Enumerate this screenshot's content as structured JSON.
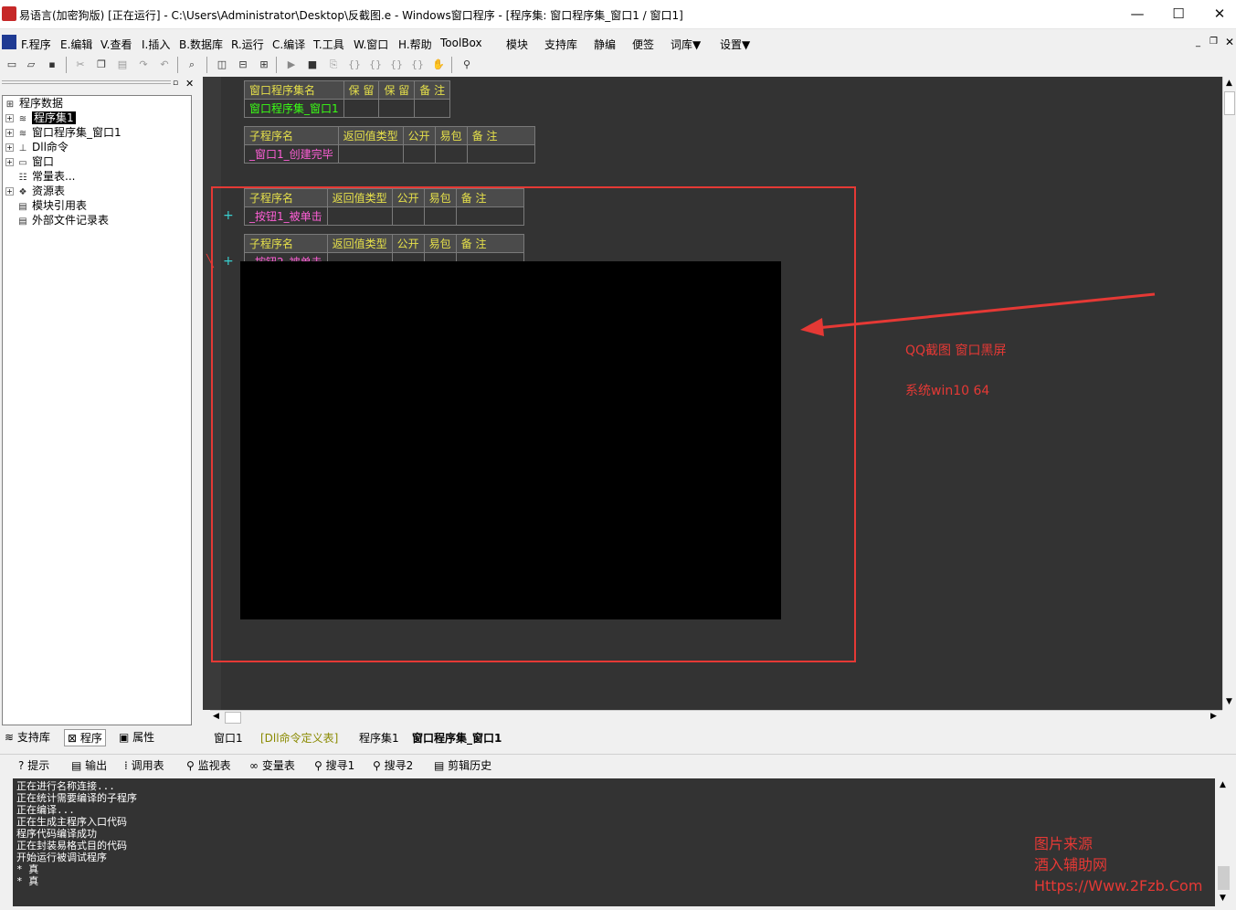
{
  "window": {
    "title": "易语言(加密狗版) [正在运行] - C:\\Users\\Administrator\\Desktop\\反截图.e - Windows窗口程序 - [程序集: 窗口程序集_窗口1 / 窗口1]",
    "minimize": "—",
    "maximize": "☐",
    "close": "✕"
  },
  "menu": [
    "F.程序",
    "E.编辑",
    "V.查看",
    "I.插入",
    "B.数据库",
    "R.运行",
    "C.编译",
    "T.工具",
    "W.窗口",
    "H.帮助",
    "ToolBox",
    "模块",
    "支持库",
    "静编",
    "便签",
    "词库▼",
    "设置▼"
  ],
  "tree": {
    "root": "程序数据",
    "items": [
      "程序集1",
      "窗口程序集_窗口1",
      "Dll命令",
      "窗口",
      "常量表...",
      "资源表",
      "模块引用表",
      "外部文件记录表"
    ]
  },
  "left_tabs": [
    "支持库",
    "程序",
    "属性"
  ],
  "code": {
    "assembly_table": {
      "headers": [
        "窗口程序集名",
        "保 留",
        "保 留",
        "备 注"
      ],
      "name": "窗口程序集_窗口1"
    },
    "sub1": {
      "headers": [
        "子程序名",
        "返回值类型",
        "公开",
        "易包",
        "备 注"
      ],
      "name": "_窗口1_创建完毕"
    },
    "sub2": {
      "headers": [
        "子程序名",
        "返回值类型",
        "公开",
        "易包",
        "备 注"
      ],
      "name": "_按钮1_被单击"
    },
    "sub3": {
      "headers": [
        "子程序名",
        "返回值类型",
        "公开",
        "易包",
        "备 注"
      ],
      "name": "_按钮2_被单击"
    }
  },
  "annotation": {
    "line1": "QQ截图 窗口黑屏",
    "line2": "系统win10 64"
  },
  "editor_tabs": [
    "窗口1",
    "[Dll命令定义表]",
    "程序集1",
    "窗口程序集_窗口1"
  ],
  "bottom_tabs": [
    "提示",
    "输出",
    "调用表",
    "监视表",
    "变量表",
    "搜寻1",
    "搜寻2",
    "剪辑历史"
  ],
  "output_lines": [
    "正在进行名称连接...",
    "正在统计需要编译的子程序",
    "正在编译...",
    "正在生成主程序入口代码",
    "程序代码编译成功",
    "正在封装易格式目的代码",
    "开始运行被调试程序",
    "* 真",
    "* 真"
  ],
  "watermark": [
    "图片来源",
    "酒入辅助网",
    "Https://Www.2Fzb.Com"
  ]
}
